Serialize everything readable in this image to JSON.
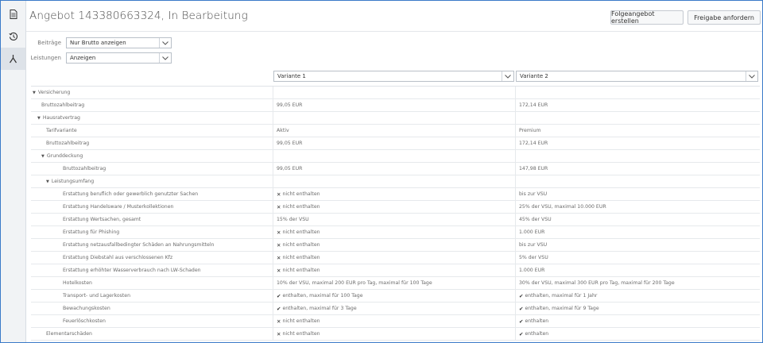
{
  "title": "Angebot 143380663324, In Bearbeitung",
  "buttons": {
    "followup": "Folgeangebot erstellen",
    "approve": "Freigabe anfordern"
  },
  "filters": {
    "beitraege_label": "Beiträge",
    "beitraege_value": "Nur Brutto anzeigen",
    "leistungen_label": "Leistungen",
    "leistungen_value": "Anzeigen"
  },
  "variants": [
    "Variante 1",
    "Variante 2"
  ],
  "rows": [
    {
      "label": "Versicherung",
      "level": 0,
      "toggle": true,
      "v1": "",
      "v2": ""
    },
    {
      "label": "Bruttozahlbeitrag",
      "level": 1,
      "toggle": false,
      "v1": "99,05 EUR",
      "v2": "172,14 EUR"
    },
    {
      "label": "Hausratvertrag",
      "level": 1,
      "toggle": true,
      "v1": "",
      "v2": ""
    },
    {
      "label": "Tarifvariante",
      "level": 2,
      "toggle": false,
      "v1": "Aktiv",
      "v2": "Premium"
    },
    {
      "label": "Bruttozahlbeitrag",
      "level": 2,
      "toggle": false,
      "v1": "99,05 EUR",
      "v2": "172,14 EUR"
    },
    {
      "label": "Grunddeckung",
      "level": 2,
      "toggle": true,
      "v1": "",
      "v2": ""
    },
    {
      "label": "Bruttozahlbeitrag",
      "level": 3,
      "toggle": false,
      "v1": "99,05 EUR",
      "v2": "147,98 EUR"
    },
    {
      "label": "Leistungsumfang",
      "level": 3,
      "toggle": true,
      "v1": "",
      "v2": ""
    },
    {
      "label": "Erstattung beruflich oder gewerblich genutzter Sachen",
      "level": 4,
      "toggle": false,
      "v1": "nicht enthalten",
      "v1m": "x",
      "v2": "bis zur VSU",
      "v2m": ""
    },
    {
      "label": "Erstattung Handelsware / Musterkollektionen",
      "level": 4,
      "toggle": false,
      "v1": "nicht enthalten",
      "v1m": "x",
      "v2": "25% der VSU, maximal 10.000 EUR",
      "v2m": ""
    },
    {
      "label": "Erstattung Wertsachen, gesamt",
      "level": 4,
      "toggle": false,
      "v1": "15% der VSU",
      "v1m": "",
      "v2": "45% der VSU",
      "v2m": ""
    },
    {
      "label": "Erstattung für Phishing",
      "level": 4,
      "toggle": false,
      "v1": "nicht enthalten",
      "v1m": "x",
      "v2": "1.000 EUR",
      "v2m": ""
    },
    {
      "label": "Erstattung netzausfallbedingter Schäden an Nahrungsmitteln",
      "level": 4,
      "toggle": false,
      "v1": "nicht enthalten",
      "v1m": "x",
      "v2": "bis zur VSU",
      "v2m": ""
    },
    {
      "label": "Erstattung Diebstahl aus verschlossenen Kfz",
      "level": 4,
      "toggle": false,
      "v1": "nicht enthalten",
      "v1m": "x",
      "v2": "5% der VSU",
      "v2m": ""
    },
    {
      "label": "Erstattung erhöhter Wasserverbrauch nach LW-Schaden",
      "level": 4,
      "toggle": false,
      "v1": "nicht enthalten",
      "v1m": "x",
      "v2": "1.000 EUR",
      "v2m": ""
    },
    {
      "label": "Hotelkosten",
      "level": 4,
      "toggle": false,
      "v1": "10% der VSU, maximal 200 EUR pro Tag, maximal für 100 Tage",
      "v1m": "",
      "v2": "30% der VSU, maximal 300 EUR pro Tag, maximal für 200 Tage",
      "v2m": ""
    },
    {
      "label": "Transport- und Lagerkosten",
      "level": 4,
      "toggle": false,
      "v1": "enthalten, maximal für 100 Tage",
      "v1m": "check",
      "v2": "enthalten, maximal für 1 Jahr",
      "v2m": "check"
    },
    {
      "label": "Bewachungskosten",
      "level": 4,
      "toggle": false,
      "v1": "enthalten, maximal für 3 Tage",
      "v1m": "check",
      "v2": "enthalten, maximal für 9 Tage",
      "v2m": "check"
    },
    {
      "label": "Feuerlöschkosten",
      "level": 4,
      "toggle": false,
      "v1": "nicht enthalten",
      "v1m": "x",
      "v2": "enthalten",
      "v2m": "check"
    },
    {
      "label": "Elementarschäden",
      "level": 2,
      "toggle": false,
      "v1": "nicht enthalten",
      "v1m": "x",
      "v2": "enthalten",
      "v2m": "check"
    }
  ]
}
